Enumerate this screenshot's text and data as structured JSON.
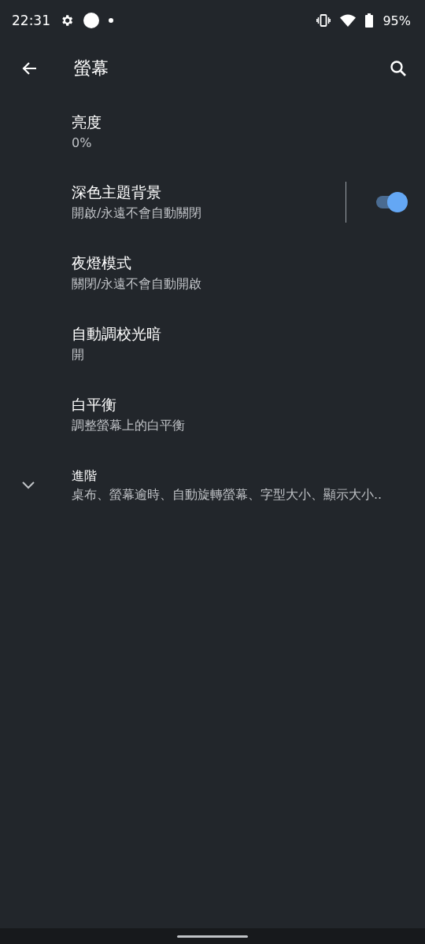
{
  "status_bar": {
    "time": "22:31",
    "battery": "95%"
  },
  "app_bar": {
    "title": "螢幕"
  },
  "items": [
    {
      "kind": "plain",
      "title": "亮度",
      "summary": "0%"
    },
    {
      "kind": "toggle",
      "title": "深色主題背景",
      "summary": "開啟/永遠不會自動關閉",
      "on": true
    },
    {
      "kind": "plain",
      "title": "夜燈模式",
      "summary": "關閉/永遠不會自動開啟"
    },
    {
      "kind": "plain",
      "title": "自動調校光暗",
      "summary": "開"
    },
    {
      "kind": "plain",
      "title": "白平衡",
      "summary": "調整螢幕上的白平衡"
    },
    {
      "kind": "expandable",
      "title": "進階",
      "summary": "桌布、螢幕逾時、自動旋轉螢幕、字型大小、顯示大小..",
      "expanded": false
    }
  ]
}
